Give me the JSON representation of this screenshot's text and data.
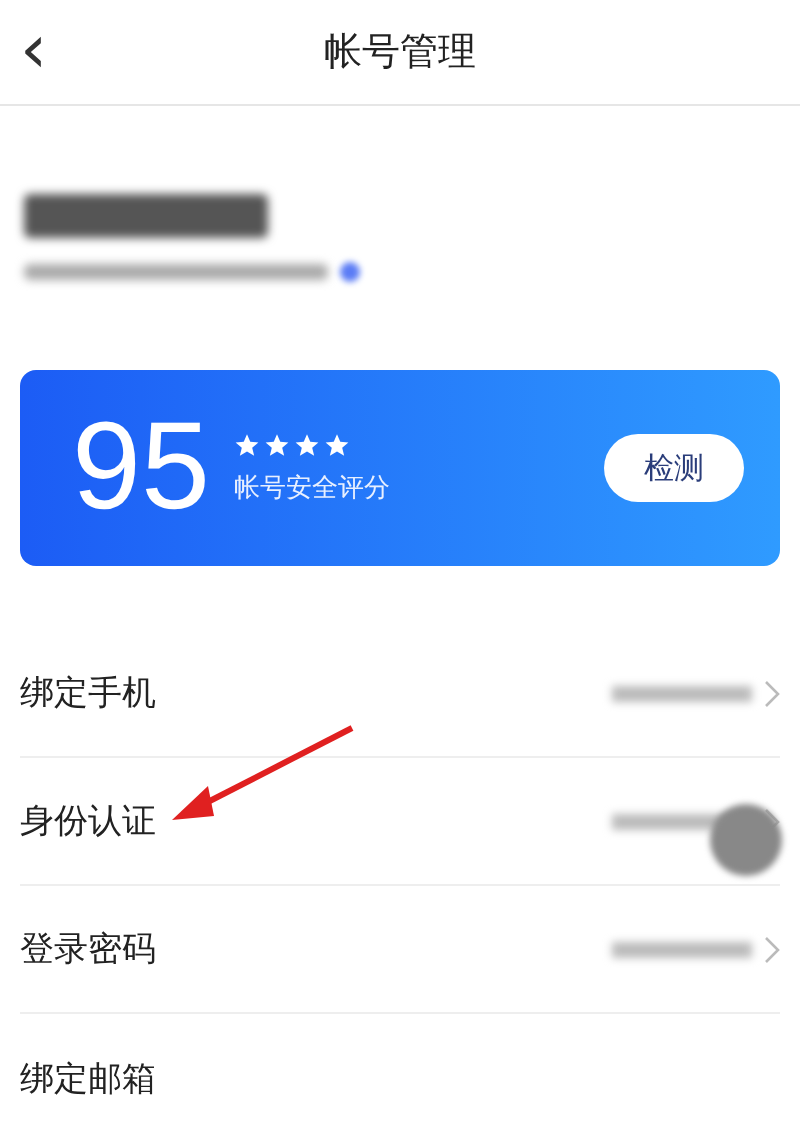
{
  "header": {
    "back": "‹",
    "title": "帐号管理"
  },
  "score_card": {
    "score": "95",
    "stars": 4,
    "label": "帐号安全评分",
    "button": "检测"
  },
  "rows": [
    {
      "label": "绑定手机",
      "chevron": true
    },
    {
      "label": "身份认证",
      "chevron": true
    },
    {
      "label": "登录密码",
      "chevron": true
    },
    {
      "label": "绑定邮箱",
      "chevron": false
    }
  ]
}
